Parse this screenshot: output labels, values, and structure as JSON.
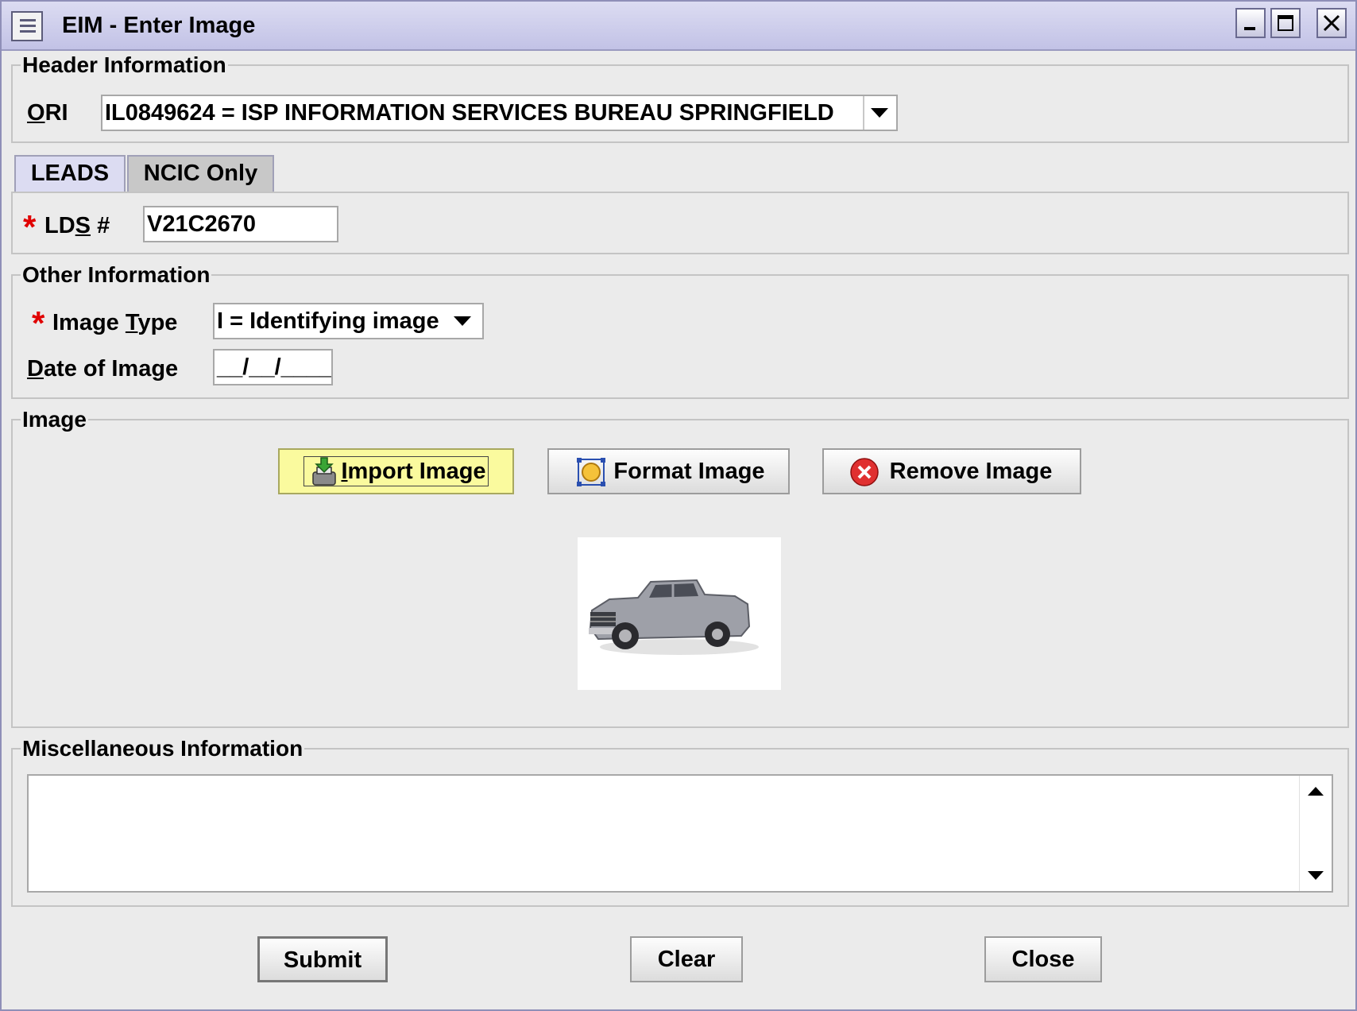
{
  "window": {
    "title": "EIM - Enter Image"
  },
  "header_info": {
    "legend": "Header Information",
    "ori_label_u": "O",
    "ori_label_rest": "RI",
    "ori_value": "IL0849624 = ISP INFORMATION SERVICES BUREAU SPRINGFIELD"
  },
  "tabs": [
    {
      "label": "LEADS",
      "selected": true
    },
    {
      "label": "NCIC Only",
      "selected": false
    }
  ],
  "leads": {
    "required_mark": "*",
    "lds_label_pre": "LD",
    "lds_label_u": "S",
    "lds_label_post": " #",
    "lds_value": "V21C2670"
  },
  "other_info": {
    "legend": "Other Information",
    "required_mark": "*",
    "image_type_pre": "Image ",
    "image_type_u": "T",
    "image_type_post": "ype",
    "image_type_value": "I = Identifying image",
    "date_label_u": "D",
    "date_label_rest": "ate of Image",
    "date_value": "__/__/____"
  },
  "image_section": {
    "legend": "Image",
    "import_u": "I",
    "import_rest": "mport Image",
    "format_label": "Format Image",
    "remove_label": "Remove Image"
  },
  "misc": {
    "legend": "Miscellaneous Information",
    "value": ""
  },
  "footer": {
    "submit": "Submit",
    "clear": "Clear",
    "close": "Close"
  },
  "icons": {
    "window_menu": "window-menu-icon",
    "minimize": "minimize-icon",
    "maximize": "maximize-icon",
    "close": "close-icon",
    "import": "import-icon",
    "format": "format-icon",
    "remove": "remove-icon"
  },
  "colors": {
    "required": "#e00000",
    "import_highlight": "#fafa9e",
    "titlebar": "#c2c2e6"
  }
}
